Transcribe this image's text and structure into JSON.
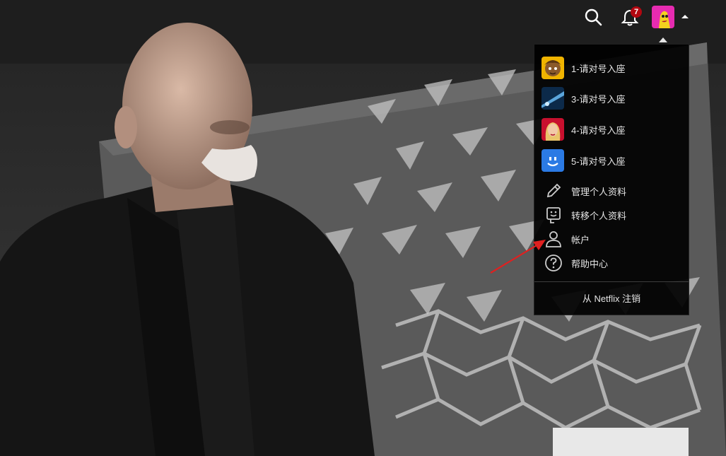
{
  "nav": {
    "notification_count": "7"
  },
  "profile_menu": {
    "profiles": [
      {
        "label": "1-请对号入座",
        "avatar": "cartoon-boy-avatar"
      },
      {
        "label": "3-请对号入座",
        "avatar": "blue-light-avatar"
      },
      {
        "label": "4-请对号入座",
        "avatar": "blonde-woman-avatar"
      },
      {
        "label": "5-请对号入座",
        "avatar": "blue-smiley-avatar"
      }
    ],
    "actions": [
      {
        "label": "管理个人资料",
        "icon": "pencil-icon"
      },
      {
        "label": "转移个人资料",
        "icon": "transfer-profile-icon"
      },
      {
        "label": "帐户",
        "icon": "person-icon"
      },
      {
        "label": "帮助中心",
        "icon": "help-icon"
      }
    ],
    "signout_label": "从 Netflix 注销"
  },
  "colors": {
    "badge": "#b20710",
    "annotation_arrow": "#e02020",
    "menu_bg": "#000000"
  }
}
